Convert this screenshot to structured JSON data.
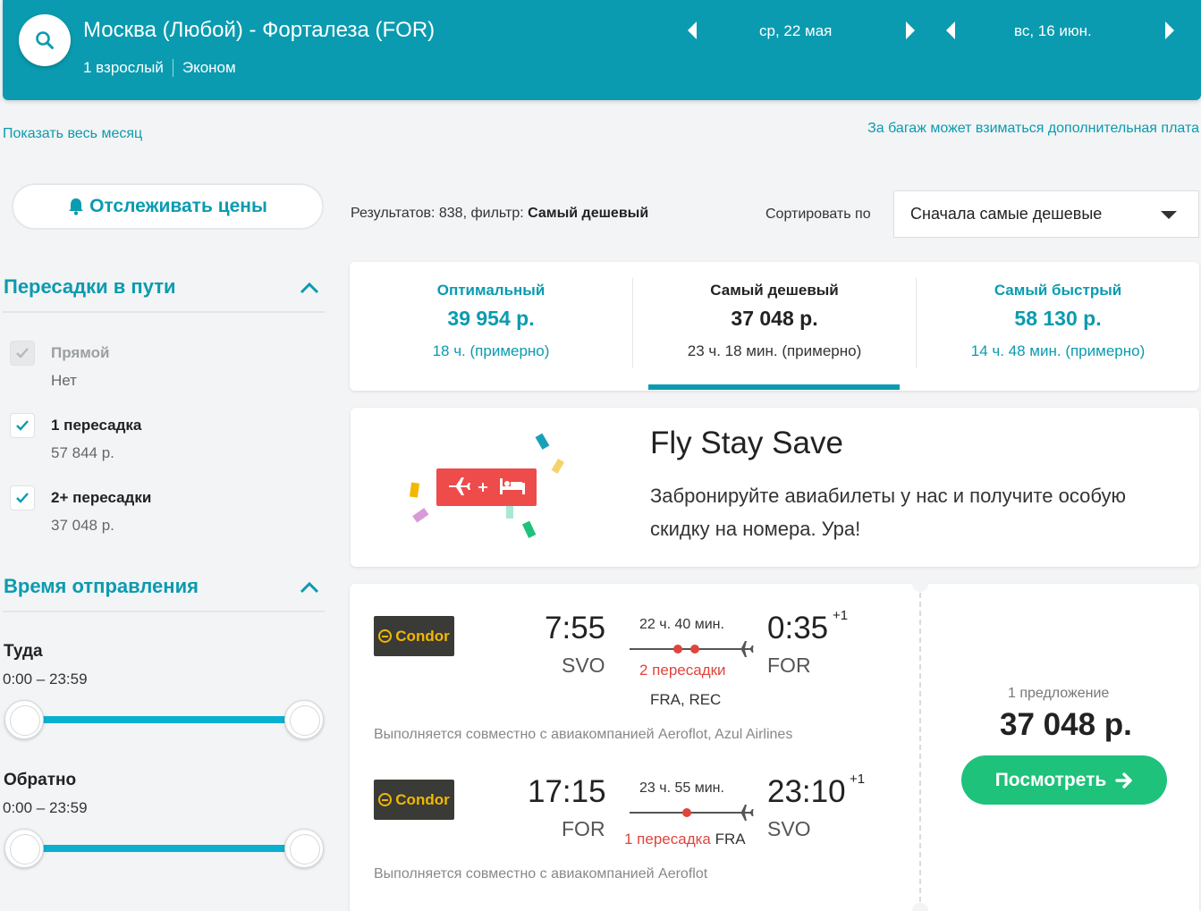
{
  "header": {
    "route": "Москва (Любой) - Форталеза (FOR)",
    "passengers": "1 взрослый",
    "cabin": "Эконом",
    "depart_date": "ср, 22 мая",
    "return_date": "вс, 16 июн."
  },
  "links": {
    "show_month": "Показать весь месяц",
    "baggage_note": "За багаж может взиматься дополнительная плата"
  },
  "track_button": "Отслеживать цены",
  "results": {
    "prefix": "Результатов: 838, фильтр: ",
    "filter": "Самый дешевый"
  },
  "sort": {
    "label": "Сортировать по",
    "selected": "Сначала самые дешевые"
  },
  "filters": {
    "stops_title": "Пересадки в пути",
    "options": [
      {
        "label": "Прямой",
        "price": "Нет",
        "checked": true,
        "disabled": true
      },
      {
        "label": "1 пересадка",
        "price": "57 844 р.",
        "checked": true,
        "disabled": false
      },
      {
        "label": "2+ пересадки",
        "price": "37 048 р.",
        "checked": true,
        "disabled": false
      }
    ],
    "time_title": "Время отправления",
    "outbound_label": "Туда",
    "outbound_range": "0:00 – 23:59",
    "return_label": "Обратно",
    "return_range": "0:00 – 23:59"
  },
  "tabs": [
    {
      "title": "Оптимальный",
      "price": "39 954 р.",
      "duration": "18 ч. (примерно)"
    },
    {
      "title": "Самый дешевый",
      "price": "37 048 р.",
      "duration": "23 ч. 18 мин. (примерно)"
    },
    {
      "title": "Самый быстрый",
      "price": "58 130 р.",
      "duration": "14 ч. 48 мин. (примерно)"
    }
  ],
  "promo": {
    "title": "Fly Stay Save",
    "text": "Забронируйте авиабилеты у нас и получите особую скидку на номера. Ура!"
  },
  "flight": {
    "outbound": {
      "airline": "Condor",
      "dep_time": "7:55",
      "dep_code": "SVO",
      "arr_time": "0:35",
      "arr_plus": "+1",
      "arr_code": "FOR",
      "duration": "22 ч. 40 мин.",
      "stops": "2 пересадки",
      "via": "FRA, REC",
      "operated": "Выполняется совместно с авиакомпанией Aeroflot, Azul Airlines"
    },
    "return": {
      "airline": "Condor",
      "dep_time": "17:15",
      "dep_code": "FOR",
      "arr_time": "23:10",
      "arr_plus": "+1",
      "arr_code": "SVO",
      "duration": "23 ч. 55 мин.",
      "stops": "1 пересадка",
      "via": "FRA",
      "operated": "Выполняется совместно с авиакомпанией Aeroflot"
    },
    "offers": "1 предложение",
    "price": "37 048 р.",
    "view_button": "Посмотреть"
  },
  "colors": {
    "accent": "#0a9bb0",
    "cta": "#1ec27a",
    "stops_red": "#e0443c"
  },
  "icons": [
    "search-icon",
    "bell-icon",
    "chevron-up-icon",
    "check-icon",
    "plane-icon",
    "bed-icon",
    "arrow-right-icon"
  ]
}
